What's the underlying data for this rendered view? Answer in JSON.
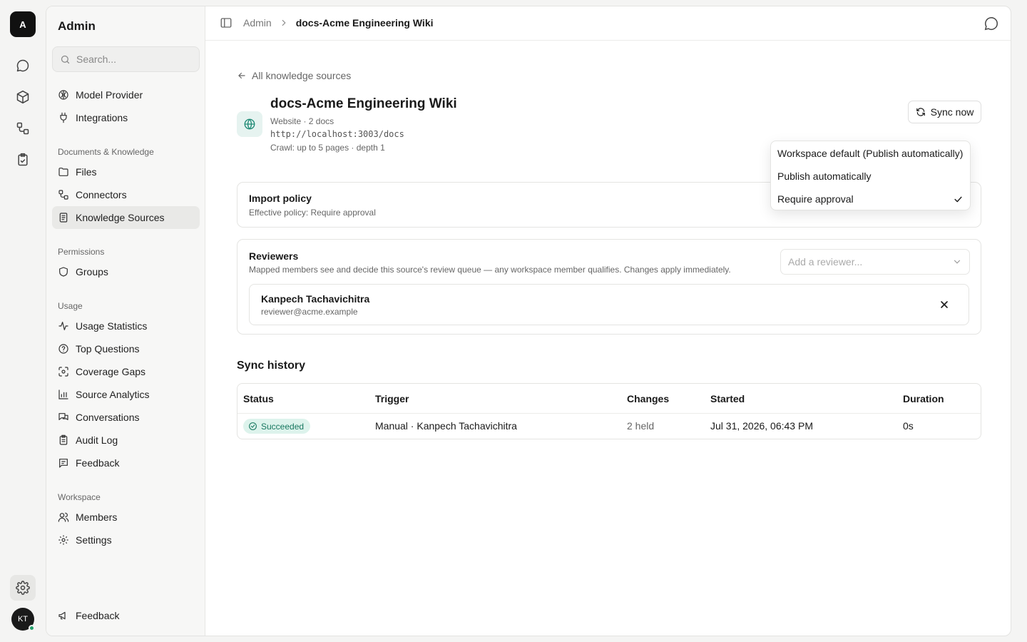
{
  "rail": {
    "logo": "A",
    "avatar": "KT",
    "icons": [
      "chat-icon",
      "cube-icon",
      "workflow-icon",
      "clipboard-check-icon",
      "settings-icon"
    ]
  },
  "sidebar": {
    "title": "Admin",
    "search_placeholder": "Search...",
    "items_top": [
      {
        "label": "Model Provider",
        "icon": "brain-icon"
      },
      {
        "label": "Integrations",
        "icon": "plug-icon"
      }
    ],
    "section_docs": "Documents & Knowledge",
    "items_docs": [
      {
        "label": "Files",
        "icon": "folder-icon"
      },
      {
        "label": "Connectors",
        "icon": "connector-icon"
      },
      {
        "label": "Knowledge Sources",
        "icon": "book-icon",
        "active": true
      }
    ],
    "section_permissions": "Permissions",
    "items_permissions": [
      {
        "label": "Groups",
        "icon": "shield-icon"
      }
    ],
    "section_usage": "Usage",
    "items_usage": [
      {
        "label": "Usage Statistics",
        "icon": "activity-icon"
      },
      {
        "label": "Top Questions",
        "icon": "question-icon"
      },
      {
        "label": "Coverage Gaps",
        "icon": "scan-icon"
      },
      {
        "label": "Source Analytics",
        "icon": "bar-chart-icon"
      },
      {
        "label": "Conversations",
        "icon": "messages-icon"
      },
      {
        "label": "Audit Log",
        "icon": "clipboard-icon"
      },
      {
        "label": "Feedback",
        "icon": "message-square-icon"
      }
    ],
    "section_workspace": "Workspace",
    "items_workspace": [
      {
        "label": "Members",
        "icon": "users-icon"
      },
      {
        "label": "Settings",
        "icon": "gear-icon"
      }
    ],
    "footer_feedback": "Feedback"
  },
  "topbar": {
    "breadcrumb_root": "Admin",
    "breadcrumb_current": "docs-Acme Engineering Wiki"
  },
  "source": {
    "back_label": "All knowledge sources",
    "title": "docs-Acme Engineering Wiki",
    "meta": "Website · 2 docs",
    "url": "http://localhost:3003/docs",
    "crawl": "Crawl: up to 5 pages · depth 1",
    "sync_label": "Sync now"
  },
  "import_policy": {
    "title": "Import policy",
    "subtitle": "Effective policy: Require approval"
  },
  "policy_dropdown": {
    "options": [
      {
        "label": "Workspace default (Publish automatically)",
        "selected": false
      },
      {
        "label": "Publish automatically",
        "selected": false
      },
      {
        "label": "Require approval",
        "selected": true
      }
    ]
  },
  "reviewers": {
    "title": "Reviewers",
    "subtitle": "Mapped members see and decide this source's review queue — any workspace member qualifies. Changes apply immediately.",
    "add_placeholder": "Add a reviewer...",
    "list": [
      {
        "name": "Kanpech Tachavichitra",
        "email": "reviewer@acme.example"
      }
    ]
  },
  "sync_history": {
    "title": "Sync history",
    "columns": [
      "Status",
      "Trigger",
      "Changes",
      "Started",
      "Duration"
    ],
    "rows": [
      {
        "status": "Succeeded",
        "trigger": "Manual · Kanpech Tachavichitra",
        "changes": "2 held",
        "started": "Jul 31, 2026, 06:43 PM",
        "duration": "0s"
      }
    ]
  },
  "colors": {
    "accent_green": "#17775f",
    "badge_bg": "#ddf3ec",
    "active_item_bg": "#e9e9e7"
  }
}
